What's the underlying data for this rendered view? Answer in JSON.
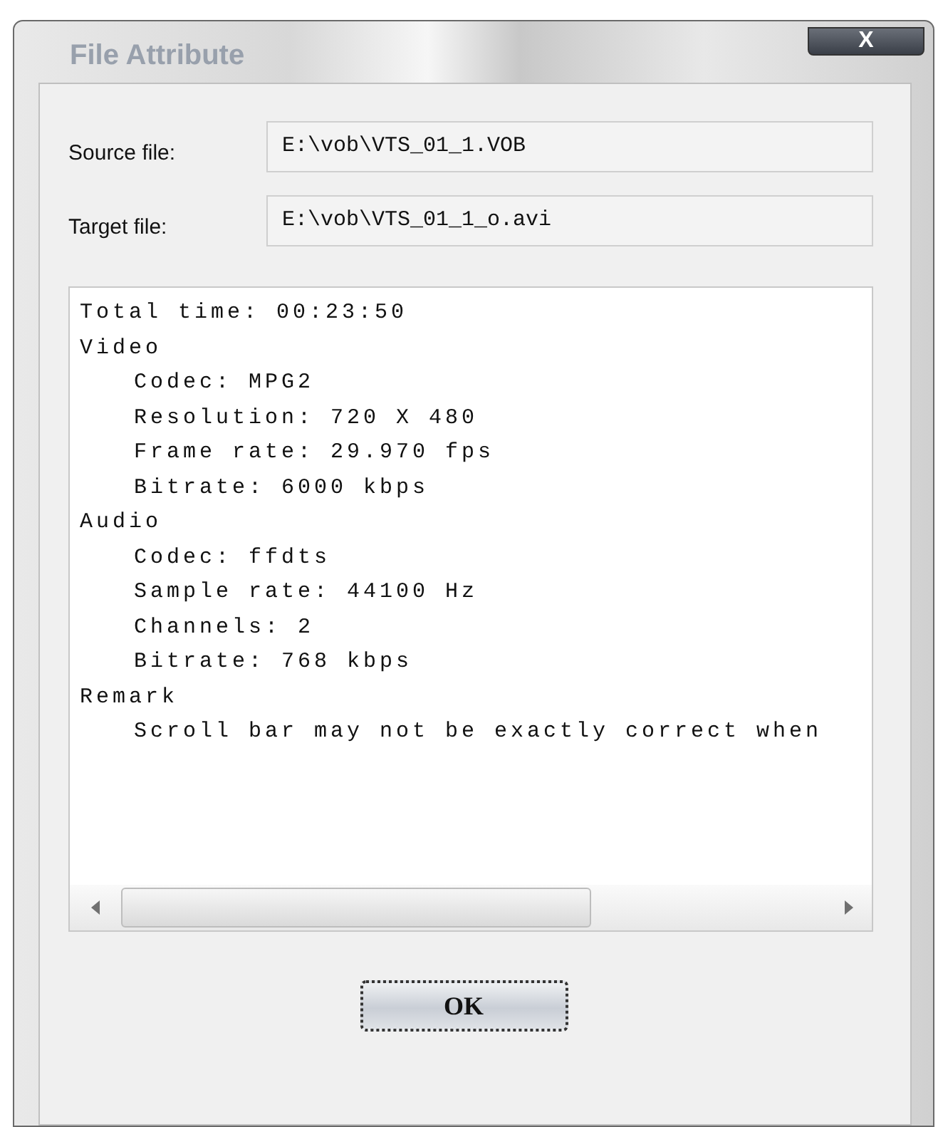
{
  "window": {
    "title": "File Attribute",
    "close_button": "X"
  },
  "fields": [
    {
      "label": "Source file:",
      "value": "E:\\vob\\VTS_01_1.VOB"
    },
    {
      "label": "Target file:",
      "value": "E:\\vob\\VTS_01_1_o.avi"
    }
  ],
  "info": [
    {
      "text": "Total time: 00:23:50"
    },
    {
      "text": "Video",
      "children": [
        {
          "text": "Codec: MPG2"
        },
        {
          "text": "Resolution: 720 X 480"
        },
        {
          "text": "Frame rate: 29.970 fps"
        },
        {
          "text": "Bitrate: 6000 kbps"
        }
      ]
    },
    {
      "text": "Audio",
      "children": [
        {
          "text": "Codec: ffdts"
        },
        {
          "text": "Sample rate: 44100 Hz"
        },
        {
          "text": "Channels: 2"
        },
        {
          "text": "Bitrate: 768 kbps"
        }
      ]
    },
    {
      "text": "Remark",
      "children": [
        {
          "text": "Scroll bar may not be exactly correct when"
        }
      ]
    }
  ],
  "buttons": [
    "OK"
  ]
}
